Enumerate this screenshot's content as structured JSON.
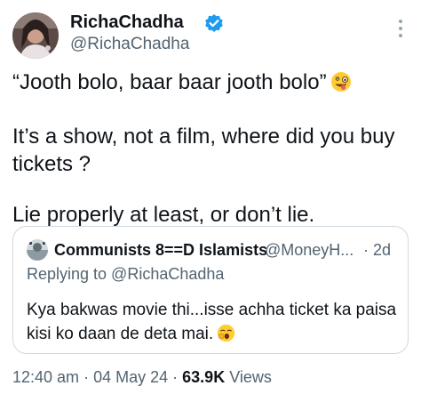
{
  "author": {
    "name": "RichaChadha",
    "handle": "@RichaChadha"
  },
  "tweet": {
    "lines": [
      "“Jooth bolo, baar baar jooth bolo”",
      "It’s a show, not a film, where did you buy tickets ?",
      "Lie properly at least, or don’t lie."
    ],
    "emoji": "zany-face"
  },
  "quote": {
    "name": "Communists 8==D Islamists",
    "handle": "@MoneyH...",
    "time": "· 2d",
    "replying_to": "Replying to @RichaChadha",
    "text": "Kya bakwas movie thi...isse achha ticket ka paisa kisi ko daan de deta mai.",
    "emoji": "yawning-face"
  },
  "meta": {
    "time": "12:40 am",
    "date": "04 May 24",
    "views_count": "63.9K",
    "views_label": "Views"
  },
  "colors": {
    "text": "#0f1419",
    "secondary": "#536471",
    "verified": "#1d9bf0",
    "border": "#cfd9de"
  }
}
